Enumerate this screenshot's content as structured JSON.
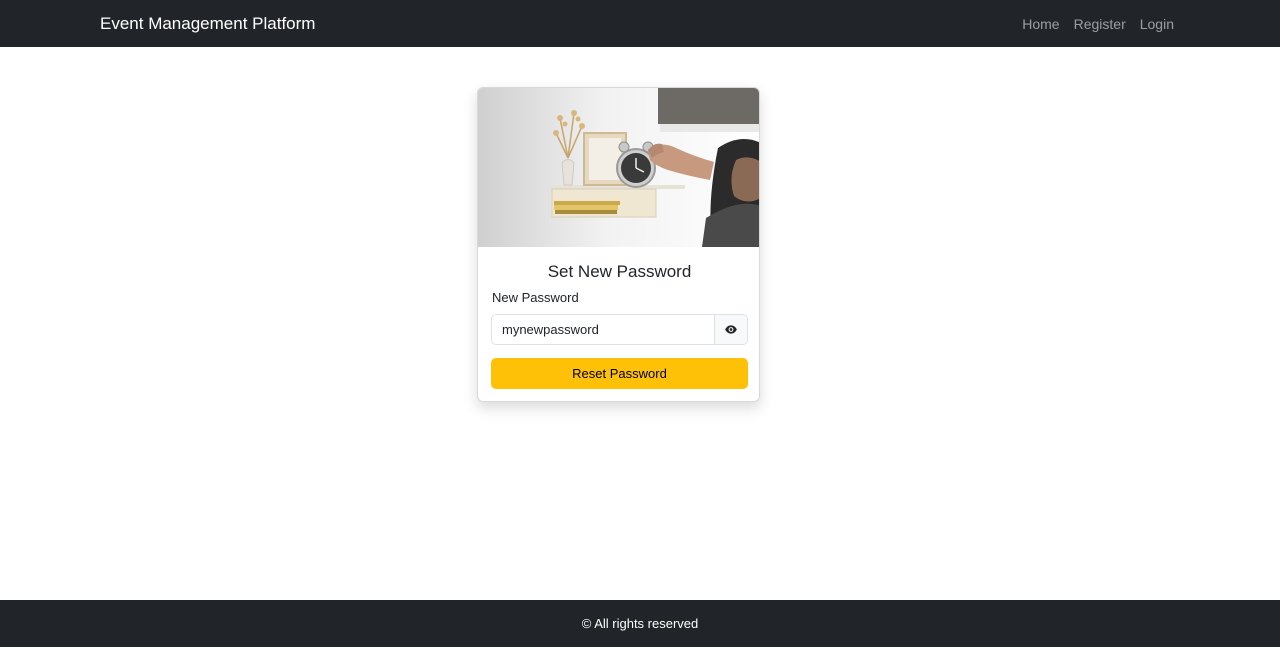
{
  "navbar": {
    "brand": "Event Management Platform",
    "links": [
      "Home",
      "Register",
      "Login"
    ]
  },
  "card": {
    "image_icon": "bedside-alarm-clock-photo",
    "title": "Set New Password",
    "password_label": "New Password",
    "password_value": "mynewpassword",
    "toggle_icon": "eye-icon",
    "submit_label": "Reset Password"
  },
  "footer": {
    "text": "© All rights reserved"
  },
  "colors": {
    "navbar_bg": "#212529",
    "footer_bg": "#212529",
    "accent": "#ffc107",
    "nav_link": "#8c8f93"
  }
}
